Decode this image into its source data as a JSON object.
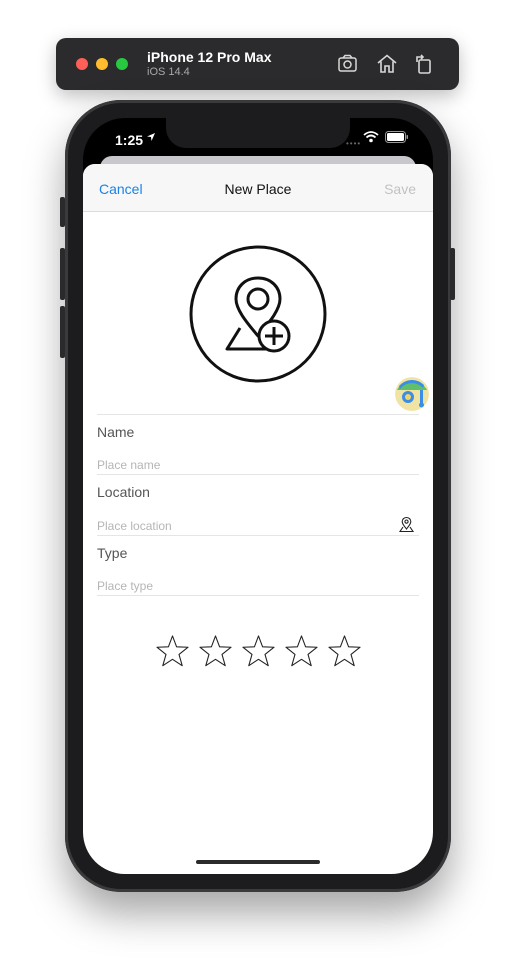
{
  "simulator": {
    "device_name": "iPhone 12 Pro Max",
    "os_version": "iOS 14.4",
    "buttons": [
      "screenshot-icon",
      "home-icon",
      "rotate-icon"
    ]
  },
  "status_bar": {
    "time": "1:25"
  },
  "nav": {
    "cancel_label": "Cancel",
    "title": "New Place",
    "save_label": "Save"
  },
  "form": {
    "name": {
      "label": "Name",
      "placeholder": "Place name"
    },
    "location": {
      "label": "Location",
      "placeholder": "Place location"
    },
    "type": {
      "label": "Type",
      "placeholder": "Place type"
    }
  },
  "rating": {
    "value": 0,
    "max": 5
  },
  "colors": {
    "accent": "#1a82e6",
    "disabled": "#c2c2c2",
    "traffic_red": "#fe5f57",
    "traffic_yellow": "#febc2e",
    "traffic_green": "#28c840"
  }
}
